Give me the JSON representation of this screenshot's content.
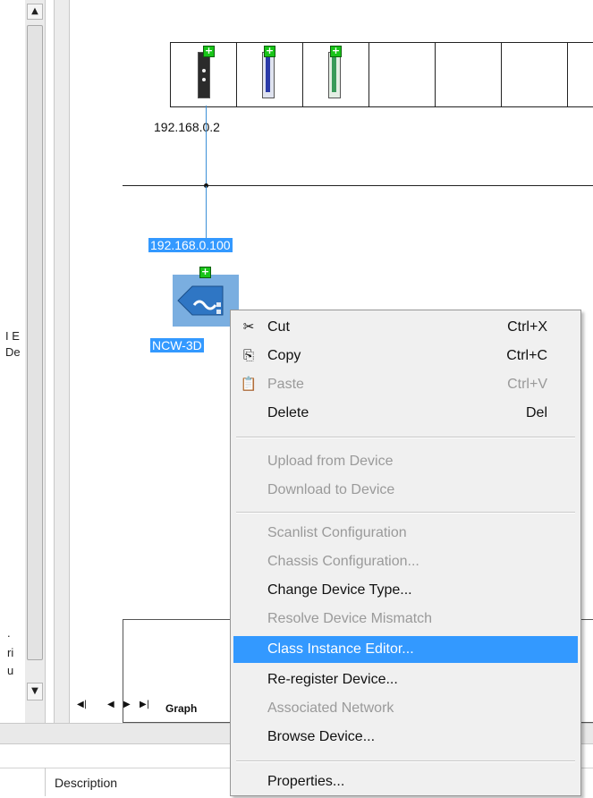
{
  "left_panel": {
    "clip_text_1": "I E",
    "clip_text_2": "De",
    "clip_text_3": ".",
    "clip_text_4": "ri",
    "clip_text_5": "u",
    "scroll_up_glyph": "▲",
    "scroll_down_glyph": "▼"
  },
  "diagram": {
    "chassis_ip": "192.168.0.2",
    "device_ip": "192.168.0.100",
    "device_name": "NCW-3D",
    "plus_glyph": "+"
  },
  "nav": {
    "first": "◀|",
    "prev": "◀",
    "next": "▶",
    "last": "▶|",
    "graph_tab": "Graph"
  },
  "bottom": {
    "description_header": "Description"
  },
  "context_menu": {
    "items": [
      {
        "label": "Cut",
        "shortcut": "Ctrl+X",
        "icon": "scissors-icon",
        "glyph": "✂"
      },
      {
        "label": "Copy",
        "shortcut": "Ctrl+C",
        "icon": "copy-icon",
        "glyph": "⎘"
      },
      {
        "label": "Paste",
        "shortcut": "Ctrl+V",
        "icon": "paste-icon",
        "glyph": "📋"
      },
      {
        "label": "Delete",
        "shortcut": "Del"
      },
      {
        "label": "Upload from Device"
      },
      {
        "label": "Download to Device"
      },
      {
        "label": "Scanlist Configuration"
      },
      {
        "label": "Chassis Configuration..."
      },
      {
        "label": "Change Device Type..."
      },
      {
        "label": "Resolve Device Mismatch"
      },
      {
        "label": "Class Instance Editor..."
      },
      {
        "label": "Re-register Device..."
      },
      {
        "label": "Associated Network"
      },
      {
        "label": "Browse Device..."
      },
      {
        "label": "Properties..."
      }
    ]
  },
  "colors": {
    "selection": "#3399ff",
    "plus_green": "#19c419",
    "menu_bg": "#f0f0f0",
    "disabled_text": "#9a9a9a"
  }
}
